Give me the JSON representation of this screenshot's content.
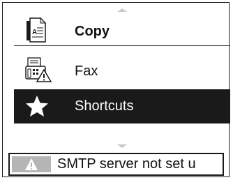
{
  "menu": {
    "items": [
      {
        "label": "Copy",
        "icon": "copy-document-icon"
      },
      {
        "label": "Fax",
        "icon": "fax-warning-icon"
      },
      {
        "label": "Shortcuts",
        "icon": "star-icon",
        "selected": true
      }
    ]
  },
  "status": {
    "icon": "warning-triangle-icon",
    "message": "SMTP server not set u"
  },
  "colors": {
    "selected_bg": "#1a1a1a",
    "selected_text": "#ffffff",
    "scroll_arrow": "#c8c8c8",
    "warning_box": "#b5b5b5"
  }
}
